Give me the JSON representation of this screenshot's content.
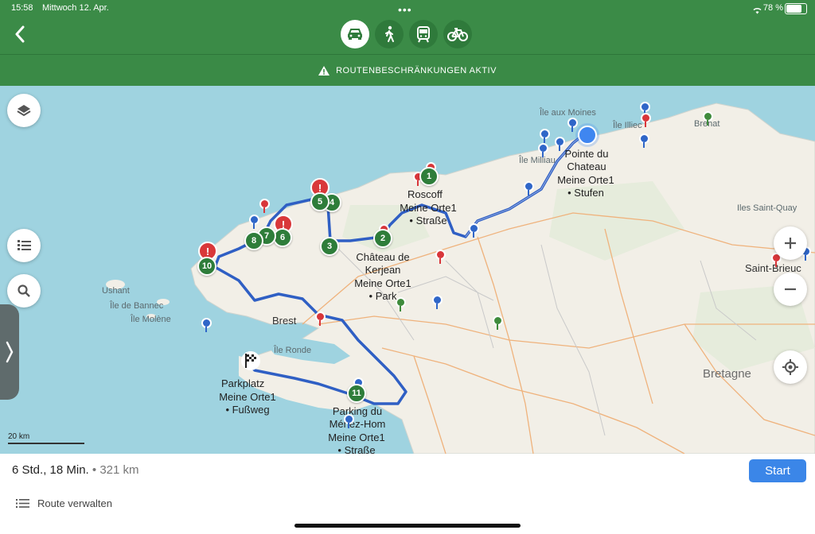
{
  "status_bar": {
    "time": "15:58",
    "date": "Mittwoch 12. Apr.",
    "battery_text": "78 %",
    "battery_level": 0.78
  },
  "header": {
    "modes": [
      {
        "name": "car-icon",
        "active": true
      },
      {
        "name": "walking-icon",
        "active": false
      },
      {
        "name": "transit-icon",
        "active": false
      },
      {
        "name": "bicycle-icon",
        "active": false
      }
    ],
    "warning": "ROUTENBESCHRÄNKUNGEN AKTIV"
  },
  "map": {
    "labels": {
      "pointe_du_chateau": "Pointe du\nChateau",
      "pointe_meine": "Meine Orte1\n• Stufen",
      "roscoff": "Roscoff",
      "roscoff_meine": "Meine Orte1\n• Straße",
      "chateau_kerjean": "Château de\nKerjean",
      "chateau_meine": "Meine Orte1\n• Park",
      "brest": "Brest",
      "parkplatz": "Parkplatz",
      "parkplatz_meine": "Meine Orte1\n• Fußweg",
      "parking_menez": "Parking du\nMénez-Hom",
      "parking_meine": "Meine Orte1\n• Straße",
      "ile_aux_moines": "Île aux Moines",
      "ile_illiec": "Île Illiec",
      "ile_milliau": "Île Milliau",
      "brehat": "Bréhat",
      "iles_saint_quay": "Iles Saint-Quay",
      "saint_brieuc": "Saint-Brieuc",
      "bretagne": "Bretagne",
      "ushant": "Ushant",
      "ile_bannec": "Île de Bannec",
      "ile_molene": "Île Molène",
      "ile_ronde": "Île Ronde"
    },
    "stops": [
      "1",
      "2",
      "3",
      "4",
      "5",
      "6",
      "7",
      "8",
      "10",
      "11"
    ],
    "scale": "20 km"
  },
  "bottom": {
    "duration": "6 Std., 18 Min.",
    "separator": "•",
    "distance": "321 km",
    "start_label": "Start",
    "manage_label": "Route verwalten"
  },
  "colors": {
    "header": "#3b8b47",
    "route": "#2f5fc4",
    "water": "#9fd3e0",
    "land": "#f2efe7",
    "start_button": "#3b86e8"
  }
}
